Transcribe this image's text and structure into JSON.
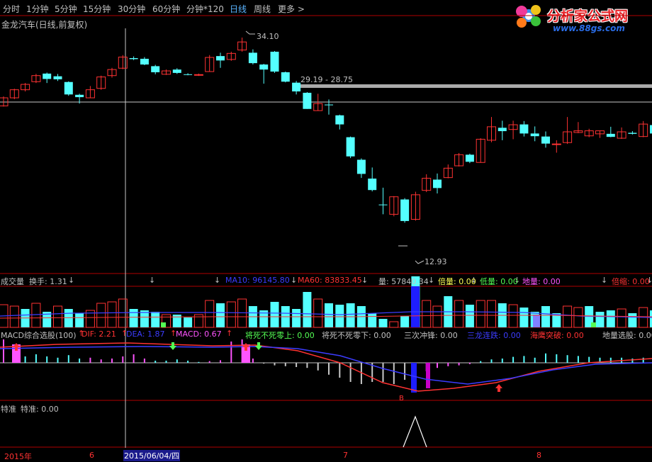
{
  "toolbar": {
    "items": [
      "分时",
      "1分钟",
      "5分钟",
      "15分钟",
      "30分钟",
      "60分钟",
      "分钟*120",
      "日线",
      "周线",
      "更多 >"
    ],
    "active_index": 7
  },
  "logo": {
    "main": "分析家公式网",
    "sub": "www.88gs.com"
  },
  "stock": {
    "title": "金龙汽车(日线,前复权)"
  },
  "price_labels": {
    "high": "34.10",
    "range": "29.19 - 28.75",
    "low": "12.93"
  },
  "volume_panel": {
    "label": "成交量",
    "turnover": "换手: 1.31",
    "ma10": "MA10: 96145.80",
    "ma60": "MA60: 83833.45",
    "vol": "量: 57840.34",
    "beiliang": "倍量: 0.00",
    "diliang": "低量: 0.00",
    "diliang2": "地量: 0.00",
    "beisuo": "倍缩: 0.00"
  },
  "macd_panel": {
    "name": "MACD综合选股(100)",
    "dif": "DIF: 2.21",
    "dea": "DEA: 1.87",
    "macd": "MACD: 0.67",
    "jsbs_up": "将死不死零上: 0.00",
    "jsbs_down": "将死不死零下: 0.00",
    "sancichong": "三次冲锋: 0.00",
    "sanlong": "三龙连跌: 0.00",
    "haiying": "海鹰突破: 0.00",
    "diliang_xg": "地量选股: 0.00",
    "buy_marker": "B"
  },
  "tezhun_panel": {
    "label": "特准",
    "value": "特准: 0.00"
  },
  "date_axis": {
    "year": "2015年",
    "m6": "6",
    "cursor_date": "2015/06/04/四",
    "m7": "7",
    "m8": "8"
  },
  "colors": {
    "up": "#ff3232",
    "down": "#54ffff",
    "ma10": "#3c3cff",
    "ma60": "#ff3232",
    "axis": "#b00000"
  },
  "candles": [
    [
      13.8,
      16.2,
      16.6,
      13.6
    ],
    [
      16.2,
      18.6,
      18.9,
      15.8
    ],
    [
      18.6,
      20.2,
      20.6,
      18.1
    ],
    [
      21.0,
      22.8,
      23.3,
      20.6
    ],
    [
      23.4,
      21.8,
      23.7,
      20.6
    ],
    [
      22.6,
      21.7,
      23.3,
      21.2
    ],
    [
      20.9,
      17.2,
      21.1,
      16.8
    ],
    [
      17.1,
      16.4,
      17.4,
      14.5
    ],
    [
      16.2,
      18.6,
      19.7,
      16.1
    ],
    [
      19.0,
      22.4,
      22.8,
      18.6
    ],
    [
      22.8,
      24.6,
      25.1,
      22.2
    ],
    [
      25.0,
      28.3,
      28.9,
      24.7
    ],
    [
      28.0,
      27.7,
      28.5,
      27.4
    ],
    [
      27.8,
      26.1,
      28.3,
      25.9
    ],
    [
      25.6,
      23.8,
      26.0,
      23.2
    ],
    [
      23.2,
      24.2,
      24.6,
      23.0
    ],
    [
      24.6,
      23.6,
      25.0,
      23.3
    ],
    [
      23.2,
      23.0,
      23.5,
      22.9
    ],
    [
      23.0,
      23.1,
      23.4,
      22.7
    ],
    [
      24.0,
      28.2,
      28.9,
      23.9
    ],
    [
      28.6,
      27.3,
      29.6,
      25.1
    ],
    [
      27.6,
      29.4,
      29.9,
      27.2
    ],
    [
      30.4,
      32.8,
      34.1,
      29.9
    ],
    [
      29.6,
      26.5,
      30.6,
      26.1
    ],
    [
      26.1,
      24.6,
      26.3,
      20.4
    ],
    [
      29.9,
      24.0,
      30.1,
      23.6
    ],
    [
      23.8,
      21.0,
      24.0,
      20.8
    ],
    [
      20.7,
      18.1,
      21.2,
      17.2
    ],
    [
      17.7,
      12.9,
      17.9,
      12.9
    ],
    [
      12.4,
      14.5,
      17.4,
      12.3
    ],
    [
      14.2,
      14.1,
      15.7,
      11.2
    ],
    [
      11.0,
      8.3,
      11.2,
      6.8
    ],
    [
      4.5,
      -1.2,
      4.7,
      -1.7
    ],
    [
      -2.2,
      -6.4,
      -1.8,
      -7.6
    ],
    [
      -7.8,
      -11.2,
      -4.5,
      -11.6
    ],
    [
      -15.5,
      -15.6,
      -10.5,
      -18.4
    ],
    [
      -18.4,
      -13.2,
      -13.0,
      -19.0
    ],
    [
      -14.0,
      -20.4,
      -13.6,
      -20.9
    ],
    [
      -19.9,
      -12.6,
      -11.7,
      -20.3
    ],
    [
      -11.3,
      -7.7,
      -6.5,
      -11.8
    ],
    [
      -8.1,
      -10.6,
      -6.3,
      -12.2
    ],
    [
      -7.5,
      -4.7,
      -3.6,
      -7.7
    ],
    [
      -4.0,
      -0.7,
      -0.2,
      -4.2
    ],
    [
      -0.7,
      -2.8,
      -0.4,
      -3.2
    ],
    [
      -3.0,
      3.9,
      4.2,
      -3.1
    ],
    [
      3.6,
      7.6,
      10.5,
      3.0
    ],
    [
      7.3,
      6.3,
      9.4,
      3.6
    ],
    [
      6.8,
      8.2,
      9.4,
      3.9
    ],
    [
      8.3,
      5.6,
      9.3,
      4.7
    ],
    [
      5.6,
      4.8,
      7.7,
      3.3
    ],
    [
      4.7,
      2.6,
      6.2,
      1.4
    ],
    [
      2.5,
      2.5,
      3.6,
      -0.1
    ],
    [
      2.9,
      6.1,
      10.5,
      2.5
    ],
    [
      5.9,
      6.4,
      9.0,
      5.7
    ],
    [
      4.9,
      6.4,
      7.0,
      4.5
    ],
    [
      5.5,
      6.4,
      6.5,
      4.3
    ],
    [
      5.5,
      4.6,
      7.6,
      4.5
    ],
    [
      4.2,
      6.1,
      7.4,
      4.0
    ],
    [
      5.8,
      5.5,
      6.3,
      5.3
    ],
    [
      4.7,
      8.4,
      9.3,
      4.5
    ],
    [
      8.1,
      5.6,
      8.3,
      4.3
    ]
  ],
  "volumes": [
    [
      32,
      1
    ],
    [
      30,
      1
    ],
    [
      26,
      0
    ],
    [
      34,
      1
    ],
    [
      22,
      0
    ],
    [
      30,
      1
    ],
    [
      26,
      0
    ],
    [
      20,
      0
    ],
    [
      24,
      1
    ],
    [
      34,
      1
    ],
    [
      36,
      1
    ],
    [
      40,
      1
    ],
    [
      26,
      0
    ],
    [
      24,
      0
    ],
    [
      22,
      0
    ],
    [
      18,
      1
    ],
    [
      18,
      0
    ],
    [
      14,
      0
    ],
    [
      18,
      1
    ],
    [
      38,
      1
    ],
    [
      34,
      0
    ],
    [
      36,
      1
    ],
    [
      40,
      1
    ],
    [
      30,
      0
    ],
    [
      24,
      0
    ],
    [
      36,
      0
    ],
    [
      30,
      0
    ],
    [
      26,
      0
    ],
    [
      50,
      0
    ],
    [
      40,
      1
    ],
    [
      34,
      0
    ],
    [
      32,
      0
    ],
    [
      34,
      0
    ],
    [
      30,
      0
    ],
    [
      20,
      0
    ],
    [
      12,
      0
    ],
    [
      8,
      1
    ],
    [
      16,
      0
    ],
    [
      72,
      0
    ],
    [
      38,
      1
    ],
    [
      30,
      1
    ],
    [
      44,
      0
    ],
    [
      38,
      1
    ],
    [
      32,
      0
    ],
    [
      38,
      1
    ],
    [
      38,
      1
    ],
    [
      34,
      0
    ],
    [
      32,
      1
    ],
    [
      28,
      0
    ],
    [
      22,
      0
    ],
    [
      30,
      0
    ],
    [
      20,
      0
    ],
    [
      30,
      1
    ],
    [
      28,
      1
    ],
    [
      30,
      0
    ],
    [
      22,
      0
    ],
    [
      24,
      0
    ],
    [
      26,
      1
    ],
    [
      20,
      0
    ],
    [
      28,
      1
    ],
    [
      24,
      0
    ]
  ],
  "macd_bars": [
    [
      0.55,
      1
    ],
    [
      0.35,
      1
    ],
    [
      0.15,
      0
    ],
    [
      0.2,
      0
    ],
    [
      0.15,
      0
    ],
    [
      0.12,
      0
    ],
    [
      0.18,
      0
    ],
    [
      0.1,
      0
    ],
    [
      0.12,
      1
    ],
    [
      0.08,
      1
    ],
    [
      0.1,
      1
    ],
    [
      0.15,
      1
    ],
    [
      0.2,
      1
    ],
    [
      0.1,
      1
    ],
    [
      0.05,
      0
    ],
    [
      0.05,
      0
    ],
    [
      0.08,
      0
    ],
    [
      0.05,
      0
    ],
    [
      0.02,
      0
    ],
    [
      0.04,
      1
    ],
    [
      0.06,
      1
    ],
    [
      0.5,
      1
    ],
    [
      0.55,
      1
    ],
    [
      0.1,
      1
    ],
    [
      -0.02,
      0
    ],
    [
      -0.06,
      0
    ],
    [
      -0.08,
      0
    ],
    [
      -0.1,
      0
    ],
    [
      -0.12,
      0
    ],
    [
      -0.18,
      0
    ],
    [
      -0.28,
      0
    ],
    [
      -0.35,
      0
    ],
    [
      -0.45,
      0
    ],
    [
      -0.5,
      0
    ],
    [
      -0.45,
      0
    ],
    [
      -0.45,
      0
    ],
    [
      -0.5,
      0
    ],
    [
      -0.4,
      0
    ],
    [
      -0.3,
      1
    ],
    [
      -0.2,
      1
    ],
    [
      -0.12,
      1
    ],
    [
      -0.08,
      1
    ],
    [
      -0.06,
      1
    ],
    [
      -0.03,
      1
    ],
    [
      0.04,
      0
    ],
    [
      0.08,
      0
    ],
    [
      0.1,
      0
    ],
    [
      0.14,
      0
    ],
    [
      0.16,
      0
    ],
    [
      0.12,
      0
    ],
    [
      0.22,
      0
    ],
    [
      0.2,
      0
    ],
    [
      0.18,
      0
    ],
    [
      0.16,
      0
    ],
    [
      0.14,
      0
    ],
    [
      0.12,
      0
    ],
    [
      0.12,
      0
    ],
    [
      0.12,
      0
    ],
    [
      0.1,
      0
    ],
    [
      0.12,
      0
    ],
    [
      0.1,
      0
    ]
  ]
}
